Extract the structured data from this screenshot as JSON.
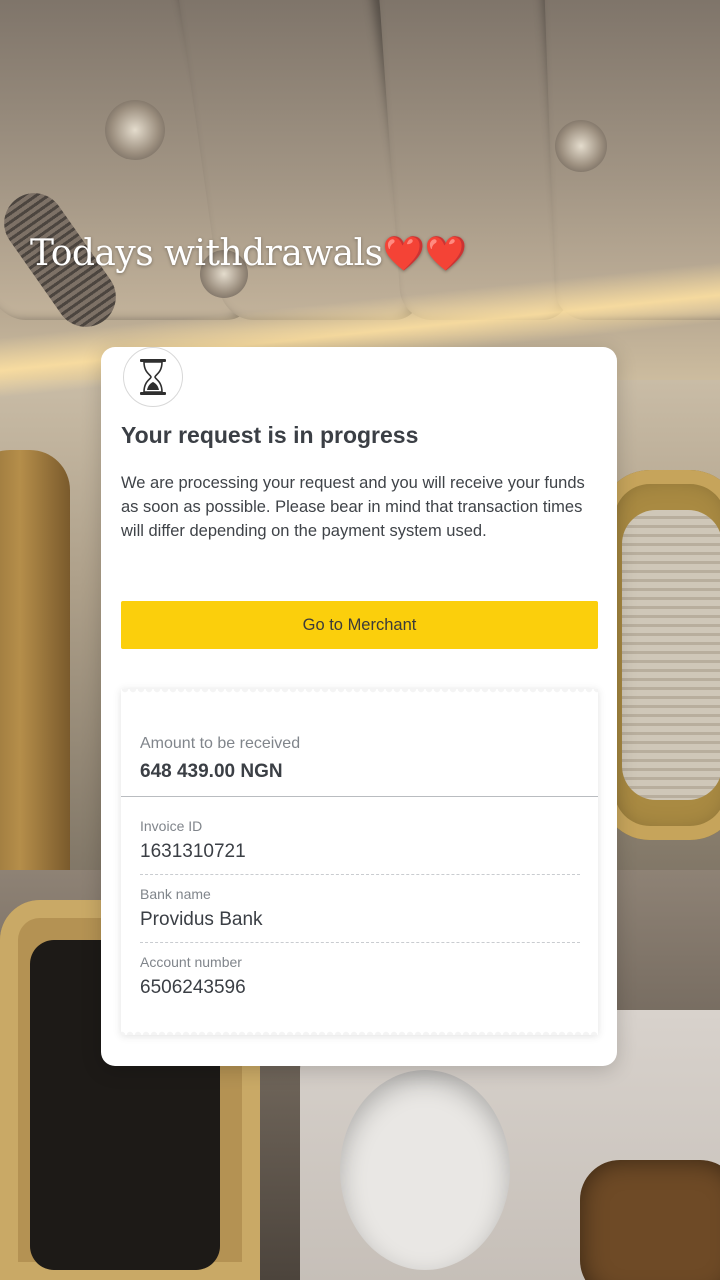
{
  "caption": {
    "text": "Todays withdrawals",
    "hearts": "❤️❤️"
  },
  "card": {
    "icon": "hourglass-icon",
    "title": "Your request is in progress",
    "description": "We are processing your request and you will receive your funds as soon as possible. Please bear in mind that transaction times will differ depending on the payment system used.",
    "button_label": "Go to Merchant",
    "button_color": "#fbcf0c"
  },
  "receipt": {
    "amount_label": "Amount to be received",
    "amount_value": "648 439.00 NGN",
    "rows": [
      {
        "label": "Invoice ID",
        "value": "1631310721"
      },
      {
        "label": "Bank name",
        "value": "Providus Bank"
      },
      {
        "label": "Account number",
        "value": "6506243596"
      }
    ]
  }
}
